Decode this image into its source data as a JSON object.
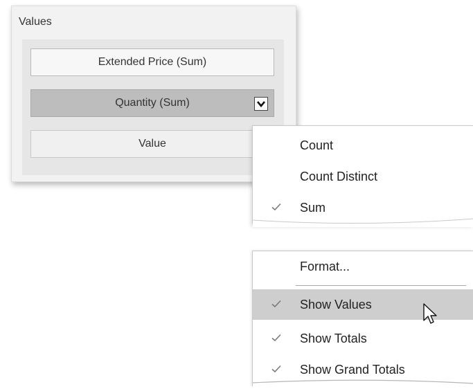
{
  "values_panel": {
    "title": "Values",
    "fields": [
      {
        "label": "Extended Price (Sum)"
      },
      {
        "label": "Quantity (Sum)"
      },
      {
        "label": "Value"
      }
    ]
  },
  "summary_menu": {
    "items": [
      {
        "label": "Count",
        "checked": false
      },
      {
        "label": "Count Distinct",
        "checked": false
      },
      {
        "label": "Sum",
        "checked": true
      }
    ]
  },
  "options_menu": {
    "items": [
      {
        "label": "Format...",
        "checked": false
      },
      {
        "label": "Show Values",
        "checked": true,
        "highlighted": true
      },
      {
        "label": "Show Totals",
        "checked": true
      },
      {
        "label": "Show Grand Totals",
        "checked": true
      }
    ]
  },
  "icons": {
    "dropdown": "chevron-down-icon",
    "check": "check-icon",
    "cursor": "mouse-pointer-icon"
  },
  "colors": {
    "highlight": "#cecece",
    "selected_field": "#bdbdbd",
    "panel": "#f2f2f2"
  }
}
